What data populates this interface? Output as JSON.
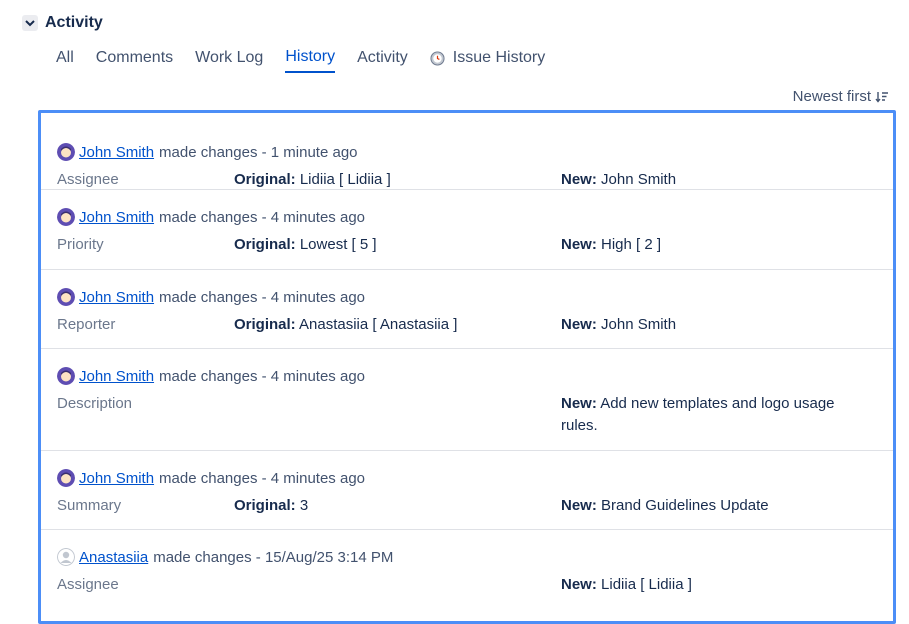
{
  "section": {
    "title": "Activity"
  },
  "tabs": [
    {
      "label": "All"
    },
    {
      "label": "Comments"
    },
    {
      "label": "Work Log"
    },
    {
      "label": "History"
    },
    {
      "label": "Activity"
    },
    {
      "label": "Issue History"
    }
  ],
  "active_tab": "History",
  "sort": {
    "label": "Newest first"
  },
  "labels": {
    "original": "Original:",
    "new": "New:"
  },
  "colors": {
    "accent": "#0052cc",
    "panel_border": "#4c8ef7",
    "avatar": "#5e4db2"
  },
  "history": [
    {
      "user": "John Smith",
      "action": "made changes - 1 minute ago",
      "field": "Assignee",
      "original": "Lidiia [ Lidiia ]",
      "new": "John Smith"
    },
    {
      "user": "John Smith",
      "action": "made changes - 4 minutes ago",
      "field": "Priority",
      "original": "Lowest [ 5 ]",
      "new": "High [ 2 ]"
    },
    {
      "user": "John Smith",
      "action": "made changes - 4 minutes ago",
      "field": "Reporter",
      "original": "Anastasiia [ Anastasiia ]",
      "new": "John Smith"
    },
    {
      "user": "John Smith",
      "action": "made changes - 4 minutes ago",
      "field": "Description",
      "original": "",
      "new": "Add new templates and logo usage rules."
    },
    {
      "user": "John Smith",
      "action": "made changes - 4 minutes ago",
      "field": "Summary",
      "original": "3",
      "new": "Brand Guidelines Update"
    },
    {
      "user": "Anastasiia",
      "action": "made changes - 15/Aug/25 3:14 PM",
      "field": "Assignee",
      "original": "",
      "new": "Lidiia [ Lidiia ]"
    }
  ]
}
